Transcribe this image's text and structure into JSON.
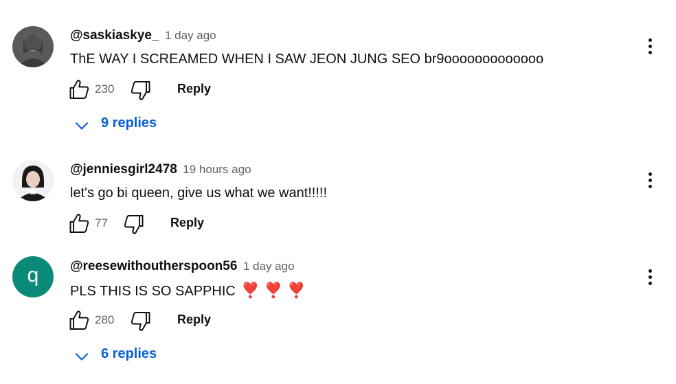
{
  "comments": [
    {
      "author": "@saskiaskye_",
      "time": "1 day ago",
      "text": "ThE WAY I SCREAMED WHEN I SAW JEON JUNG SEO br9ooooooooooooo",
      "likes": "230",
      "reply_label": "Reply",
      "replies_label": "9 replies",
      "avatar_icon": "profile-photo"
    },
    {
      "author": "@jenniesgirl2478",
      "time": "19 hours ago",
      "text": "let's go bi queen, give us what we want!!!!!",
      "likes": "77",
      "reply_label": "Reply",
      "avatar_icon": "profile-photo"
    },
    {
      "author": "@reesewithoutherspoon56",
      "time": "1 day ago",
      "text": "PLS THIS IS SO SAPPHIC",
      "emoji": "❣️ ❣️ ❣️",
      "likes": "280",
      "reply_label": "Reply",
      "replies_label": "6 replies",
      "avatar_letter": "q",
      "avatar_color": "#0a8a78"
    }
  ],
  "colors": {
    "link": "#065fd4",
    "meta": "#606060",
    "heart": "#e0201e"
  }
}
